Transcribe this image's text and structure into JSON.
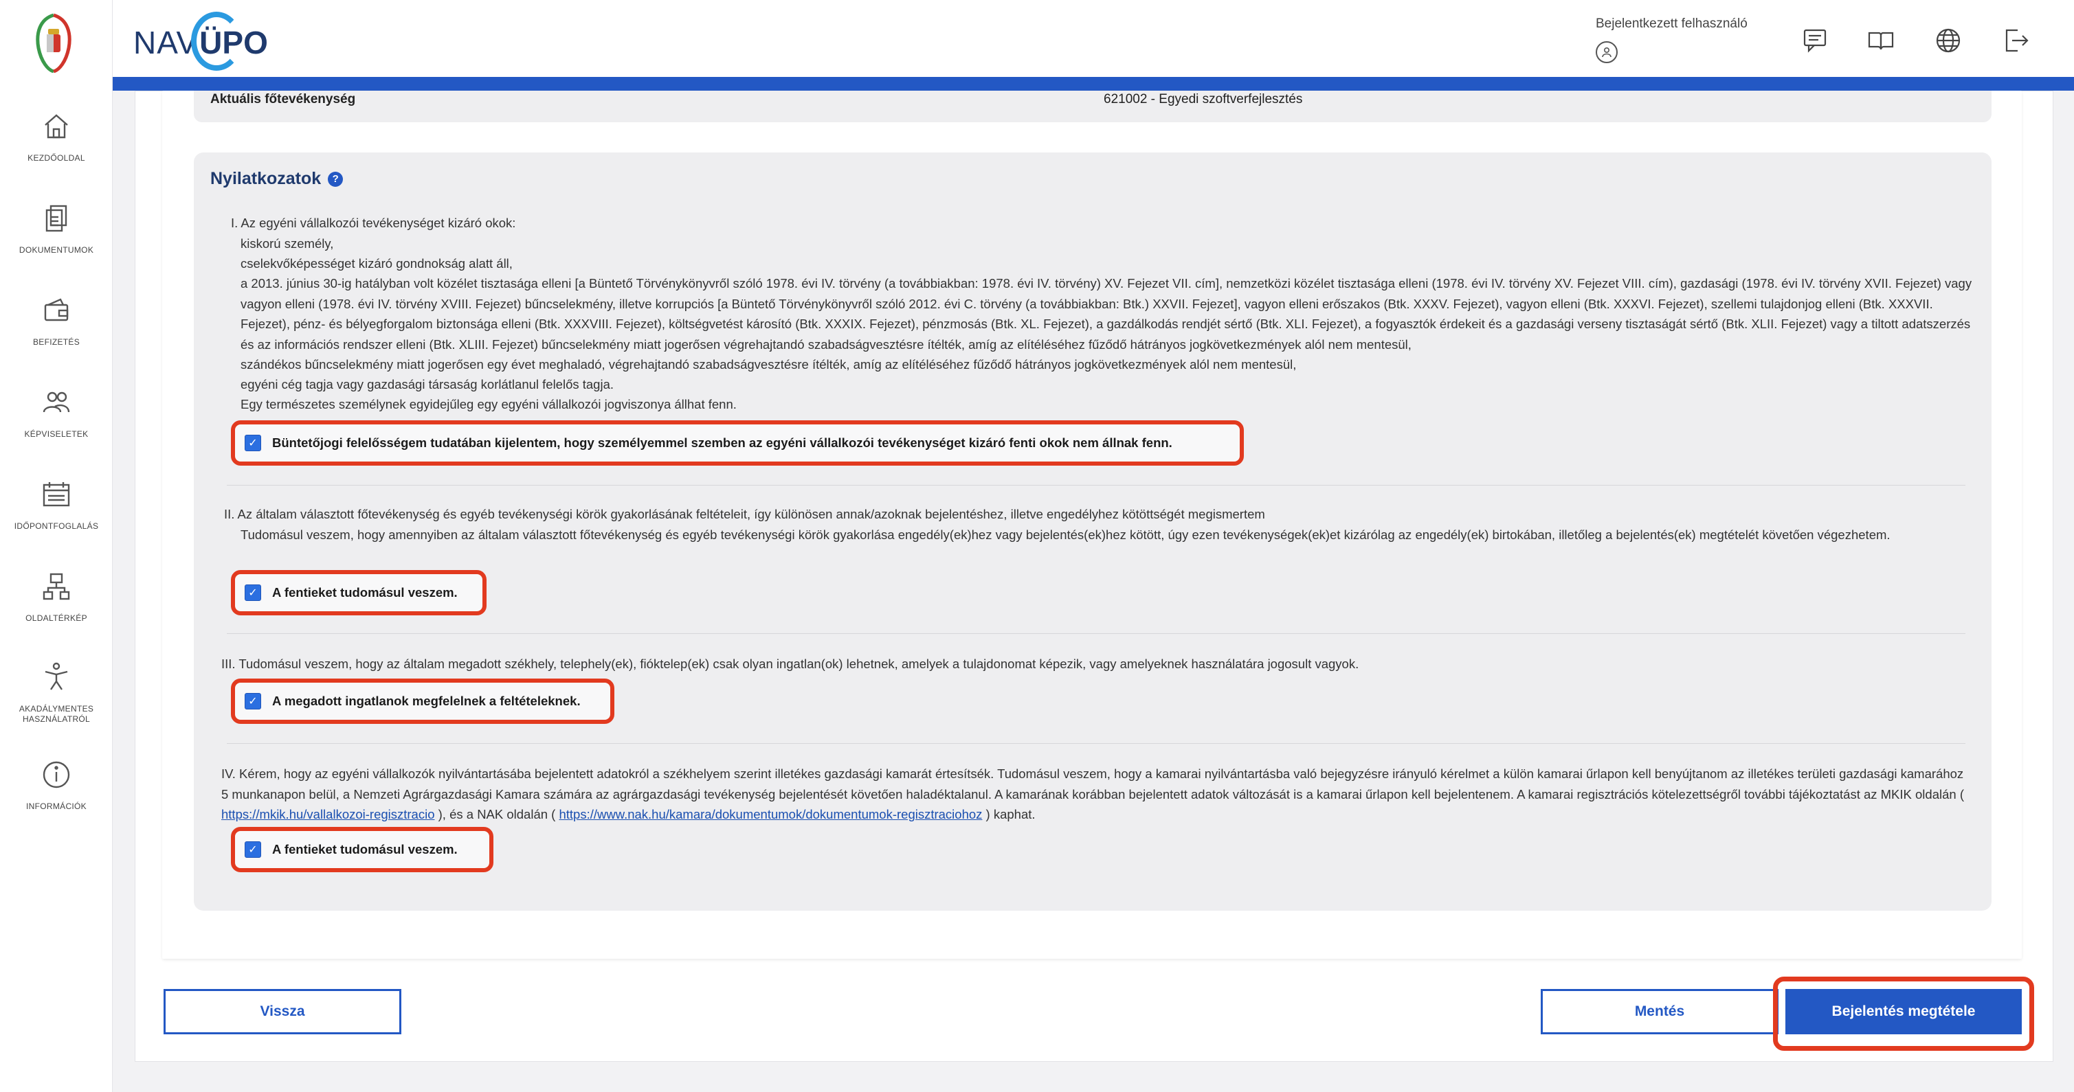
{
  "app": {
    "brand_left": "NAV",
    "brand_right": "ÜPO"
  },
  "user": {
    "label": "Bejelentkezett felhasználó"
  },
  "sidebar": {
    "items": [
      {
        "label": "KEZDŐOLDAL",
        "icon": "home-icon"
      },
      {
        "label": "DOKUMENTUMOK",
        "icon": "documents-icon"
      },
      {
        "label": "BEFIZETÉS",
        "icon": "wallet-icon"
      },
      {
        "label": "KÉPVISELETEK",
        "icon": "people-icon"
      },
      {
        "label": "IDŐPONTFOGLALÁS",
        "icon": "calendar-icon"
      },
      {
        "label": "OLDALTÉRKÉP",
        "icon": "sitemap-icon"
      },
      {
        "label": "AKADÁLYMENTES HASZNÁLATRÓL",
        "icon": "accessibility-icon"
      },
      {
        "label": "INFORMÁCIÓK",
        "icon": "info-icon"
      }
    ]
  },
  "header_icons": [
    "chat-icon",
    "book-icon",
    "globe-icon",
    "logout-icon"
  ],
  "activity": {
    "label": "Aktuális főtevékenység",
    "value": "621002 - Egyedi szoftverfejlesztés"
  },
  "declarations": {
    "title": "Nyilatkozatok",
    "section1": {
      "heading": "I. Az egyéni vállalkozói tevékenységet kizáró okok:",
      "lines": [
        "kiskorú személy,",
        "cselekvőképességet kizáró gondnokság alatt áll,",
        "a 2013. június 30-ig hatályban volt közélet tisztasága elleni [a Büntető Törvénykönyvről szóló 1978. évi IV. törvény (a továbbiakban: 1978. évi IV. törvény) XV. Fejezet VII. cím], nemzetközi közélet tisztasága elleni (1978. évi IV. törvény XV. Fejezet VIII. cím), gazdasági (1978. évi IV. törvény XVII. Fejezet) vagy vagyon elleni (1978. évi IV. törvény XVIII. Fejezet) bűncselekmény, illetve korrupciós [a Büntető Törvénykönyvről szóló 2012. évi C. törvény (a továbbiakban: Btk.) XXVII. Fejezet], vagyon elleni erőszakos (Btk. XXXV. Fejezet), vagyon elleni (Btk. XXXVI. Fejezet), szellemi tulajdonjog elleni (Btk. XXXVII. Fejezet), pénz- és bélyegforgalom biztonsága elleni (Btk. XXXVIII. Fejezet), költségvetést károsító (Btk. XXXIX. Fejezet), pénzmosás (Btk. XL. Fejezet), a gazdálkodás rendjét sértő (Btk. XLI. Fejezet), a fogyasztók érdekeit és a gazdasági verseny tisztaságát sértő (Btk. XLII. Fejezet) vagy a tiltott adatszerzés és az információs rendszer elleni (Btk. XLIII. Fejezet) bűncselekmény miatt jogerősen végrehajtandó szabadságvesztésre ítélték, amíg az elítéléséhez fűződő hátrányos jogkövetkezmények alól nem mentesül,",
        "szándékos bűncselekmény miatt jogerősen egy évet meghaladó, végrehajtandó szabadságvesztésre ítélték, amíg az elítéléséhez fűződő hátrányos jogkövetkezmények alól nem mentesül,",
        "egyéni cég tagja vagy gazdasági társaság korlátlanul felelős tagja.",
        "Egy természetes személynek egyidejűleg egy egyéni vállalkozói jogviszonya állhat fenn."
      ],
      "checkbox": "Büntetőjogi felelősségem tudatában kijelentem, hogy személyemmel szemben az egyéni vállalkozói tevékenységet kizáró fenti okok nem állnak fenn."
    },
    "section2": {
      "heading": "II. Az általam választott főtevékenység és egyéb tevékenységi körök gyakorlásának feltételeit, így különösen annak/azoknak bejelentéshez, illetve engedélyhez kötöttségét megismertem",
      "text": "Tudomásul veszem, hogy amennyiben az általam választott főtevékenység és egyéb tevékenységi körök gyakorlása engedély(ek)hez vagy bejelentés(ek)hez kötött, úgy ezen tevékenységek(ek)et kizárólag az engedély(ek) birtokában, illetőleg a bejelentés(ek) megtételét követően végezhetem.",
      "checkbox": "A fentieket tudomásul veszem."
    },
    "section3": {
      "text": "III. Tudomásul veszem, hogy az általam megadott székhely, telephely(ek), fióktelep(ek) csak olyan ingatlan(ok) lehetnek, amelyek a tulajdonomat képezik, vagy amelyeknek használatára jogosult vagyok.",
      "checkbox": "A megadott ingatlanok megfelelnek a feltételeknek."
    },
    "section4": {
      "text_a": "IV. Kérem, hogy az egyéni vállalkozók nyilvántartásába bejelentett adatokról a székhelyem szerint illetékes gazdasági kamarát értesítsék. Tudomásul veszem, hogy a kamarai nyilvántartásba való bejegyzésre irányuló kérelmet a külön kamarai űrlapon kell benyújtanom az illetékes területi gazdasági kamarához 5 munkanapon belül, a Nemzeti Agrárgazdasági Kamara számára az agrárgazdasági tevékenység bejelentését követően haladéktalanul. A kamarának korábban bejelentett adatok változását is a kamarai űrlapon kell bejelentenem. A kamarai regisztrációs kötelezettségről további tájékoztatást az MKIK oldalán (",
      "link1": "https://mkik.hu/vallalkozoi-regisztracio",
      "text_b": "), és a NAK oldalán (",
      "link2": "https://www.nak.hu/kamara/dokumentumok/dokumentumok-regisztraciohoz",
      "text_c": ") kaphat.",
      "checkbox": "A fentieket tudomásul veszem."
    }
  },
  "buttons": {
    "back": "Vissza",
    "save": "Mentés",
    "submit": "Bejelentés megtétele"
  },
  "colors": {
    "primary": "#2358c4",
    "highlight": "#e23a1f",
    "brand_arc": "#2b9ae0"
  }
}
